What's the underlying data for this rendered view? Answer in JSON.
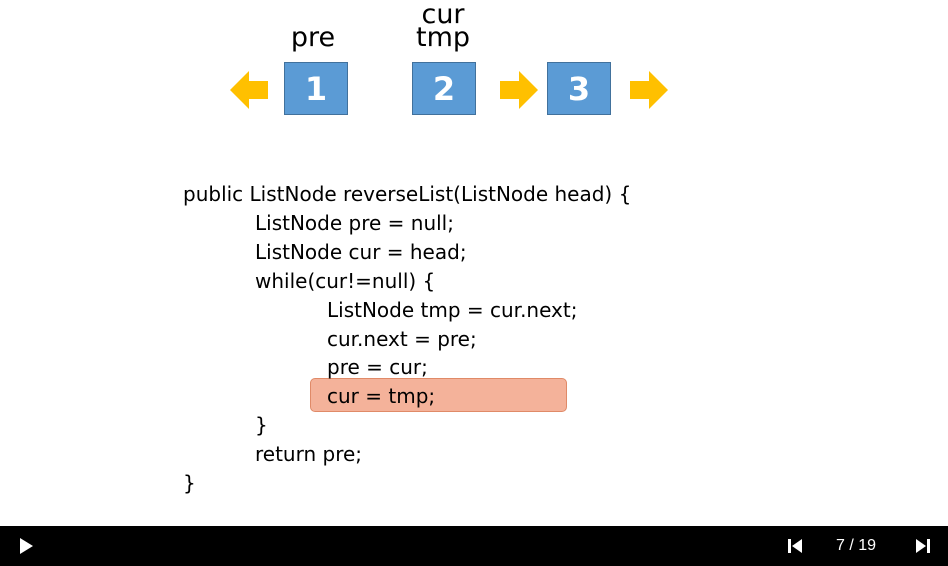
{
  "diagram": {
    "pointer_labels": {
      "pre": "pre",
      "cur": "cur",
      "tmp": "tmp"
    },
    "nodes": [
      "1",
      "2",
      "3"
    ],
    "colors": {
      "node_fill": "#5b9bd5",
      "arrow": "#ffc000",
      "highlight": "#f4b29a"
    }
  },
  "code": {
    "lines": [
      "public ListNode reverseList(ListNode head) {",
      "ListNode pre = null;",
      "ListNode cur = head;",
      "while(cur!=null) {",
      "ListNode tmp = cur.next;",
      "cur.next = pre;",
      "pre = cur;",
      "cur = tmp;",
      "}",
      "return pre;",
      "}"
    ],
    "highlighted_line": "cur = tmp;"
  },
  "player": {
    "page_counter": "7 / 19",
    "icons": [
      "play-icon",
      "previous-slide-icon",
      "next-slide-icon"
    ]
  }
}
